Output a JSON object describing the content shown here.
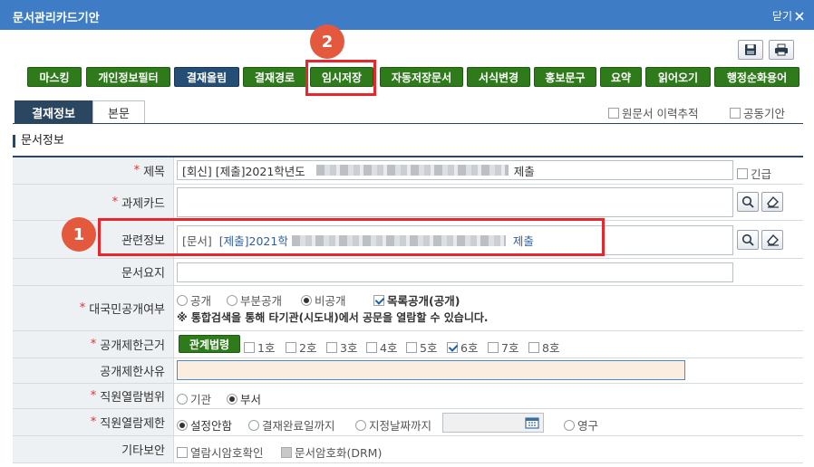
{
  "window": {
    "title": "문서관리카드기안",
    "close_label": "닫기"
  },
  "toolbar": {
    "buttons": [
      "마스킹",
      "개인정보필터",
      "결재올림",
      "결재경로",
      "임시저장",
      "자동저장문서",
      "서식변경",
      "홍보문구",
      "요약",
      "읽어오기",
      "행정순화용어"
    ]
  },
  "callouts": [
    "2",
    "1"
  ],
  "tabs": {
    "approval_info": "결재정보",
    "body": "본문"
  },
  "top_options": {
    "original_history": "원문서 이력추적",
    "joint_draft": "공동기안"
  },
  "section_title": "문서정보",
  "form": {
    "subject": {
      "label": "제목",
      "value_prefix": "[회신] [제출]2021학년도",
      "value_suffix": "제출",
      "urgent_label": "긴급"
    },
    "task_card": {
      "label": "과제카드"
    },
    "related_info": {
      "label": "관련정보",
      "type_tag": "[문서]",
      "link_prefix": "[제출]2021학",
      "link_suffix": "제출"
    },
    "summary": {
      "label": "문서요지"
    },
    "public_disclosure": {
      "label": "대국민공개여부",
      "options": [
        "공개",
        "부분공개",
        "비공개"
      ],
      "list_public_label": "목록공개(공개)",
      "notice": "※ 통합검색을 통해 타기관(시도내)에서 공문을 열람할 수 있습니다."
    },
    "restriction_basis": {
      "label": "공개제한근거",
      "law_button": "관계법령",
      "items": [
        "1호",
        "2호",
        "3호",
        "4호",
        "5호",
        "6호",
        "7호",
        "8호"
      ]
    },
    "restriction_reason": {
      "label": "공개제한사유"
    },
    "viewing_scope": {
      "label": "직원열람범위",
      "options": [
        "기관",
        "부서"
      ]
    },
    "viewing_limit": {
      "label": "직원열람제한",
      "options": [
        "설정안함",
        "결재완료일까지",
        "지정날짜까지",
        "영구"
      ]
    },
    "other_security": {
      "label": "기타보안",
      "options": [
        "열람시암호확인",
        "문서암호화(DRM)"
      ]
    }
  }
}
